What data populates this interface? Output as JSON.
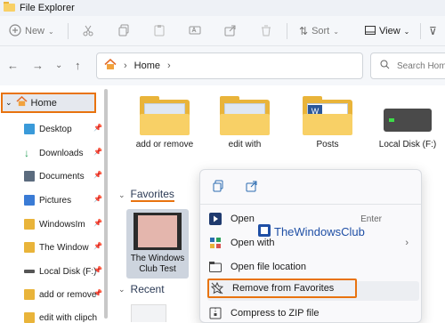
{
  "window": {
    "title": "File Explorer"
  },
  "toolbar": {
    "new_label": "New",
    "sort_label": "Sort",
    "view_label": "View"
  },
  "address": {
    "path_item": "Home",
    "search_placeholder": "Search Hom"
  },
  "sidebar": {
    "home_label": "Home",
    "items": [
      {
        "label": "Desktop",
        "icon": "desktop-icon",
        "color": "#3a9ad9",
        "pinned": true
      },
      {
        "label": "Downloads",
        "icon": "download-icon",
        "color": "#2aa15b",
        "pinned": true
      },
      {
        "label": "Documents",
        "icon": "document-icon",
        "color": "#5b6b7e",
        "pinned": true
      },
      {
        "label": "Pictures",
        "icon": "pictures-icon",
        "color": "#3a7bd5",
        "pinned": true
      },
      {
        "label": "WindowsIm",
        "icon": "folder-icon",
        "color": "#e9b43a",
        "pinned": true
      },
      {
        "label": "The Window",
        "icon": "folder-icon",
        "color": "#e9b43a",
        "pinned": true
      },
      {
        "label": "Local Disk (F:)",
        "icon": "drive-icon",
        "color": "#555555",
        "pinned": true
      },
      {
        "label": "add or remove",
        "icon": "folder-icon",
        "color": "#e9b43a",
        "pinned": true
      },
      {
        "label": "edit with clipch",
        "icon": "folder-icon",
        "color": "#e9b43a",
        "pinned": false
      }
    ]
  },
  "quick_access": [
    {
      "label": "add or remove",
      "icon": "folder-icon"
    },
    {
      "label": "edit with",
      "icon": "folder-icon"
    },
    {
      "label": "Posts",
      "icon": "folder-icon"
    },
    {
      "label": "Local Disk (F:)",
      "icon": "drive-icon"
    }
  ],
  "favorites": {
    "header": "Favorites",
    "item_caption": "The Windows Club Test"
  },
  "recent": {
    "header": "Recent"
  },
  "context_menu": {
    "items": [
      {
        "label": "Open",
        "accelerator": "Enter",
        "icon": "play-icon"
      },
      {
        "label": "Open with",
        "accelerator": "",
        "icon": "open-with-icon",
        "submenu": true
      },
      {
        "label": "Open file location",
        "accelerator": "",
        "icon": "folder-icon"
      },
      {
        "label": "Remove from Favorites",
        "accelerator": "",
        "icon": "unstar-icon",
        "highlighted": true
      },
      {
        "label": "Compress to ZIP file",
        "accelerator": "",
        "icon": "zip-icon"
      }
    ]
  },
  "watermark": {
    "text": "TheWindowsClub"
  },
  "colors": {
    "accent_highlight": "#e8730f",
    "folder": "#e9b43a",
    "brand": "#1f4fa5"
  }
}
